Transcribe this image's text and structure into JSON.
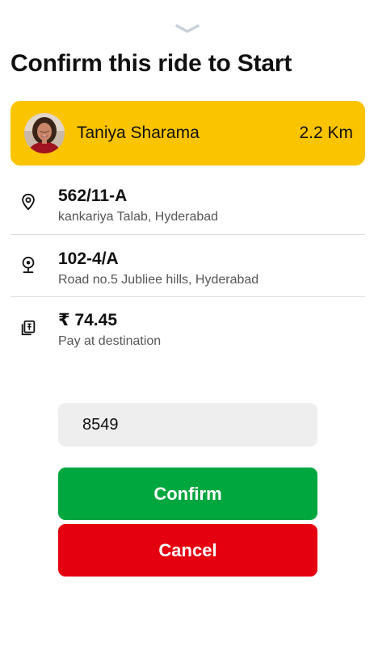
{
  "sheet": {
    "handle_icon": "chevron-down-icon",
    "title": "Confirm this ride to Start"
  },
  "rider": {
    "name": "Taniya Sharama",
    "distance": "2.2 Km",
    "avatar_icon": "avatar",
    "card_color": "#fbc401"
  },
  "pickup": {
    "icon": "location-pin-icon",
    "title": "562/11-A",
    "subtitle": "kankariya Talab, Hyderabad"
  },
  "dropoff": {
    "icon": "destination-pin-icon",
    "title": "102-4/A",
    "subtitle": "Road no.5 Jubliee hills, Hyderabad"
  },
  "payment": {
    "icon": "cash-icon",
    "amount": "₹ 74.45",
    "note": "Pay at destination"
  },
  "otp": {
    "value": "8549"
  },
  "actions": {
    "confirm_label": "Confirm",
    "cancel_label": "Cancel",
    "confirm_color": "#00a63e",
    "cancel_color": "#e50010"
  }
}
